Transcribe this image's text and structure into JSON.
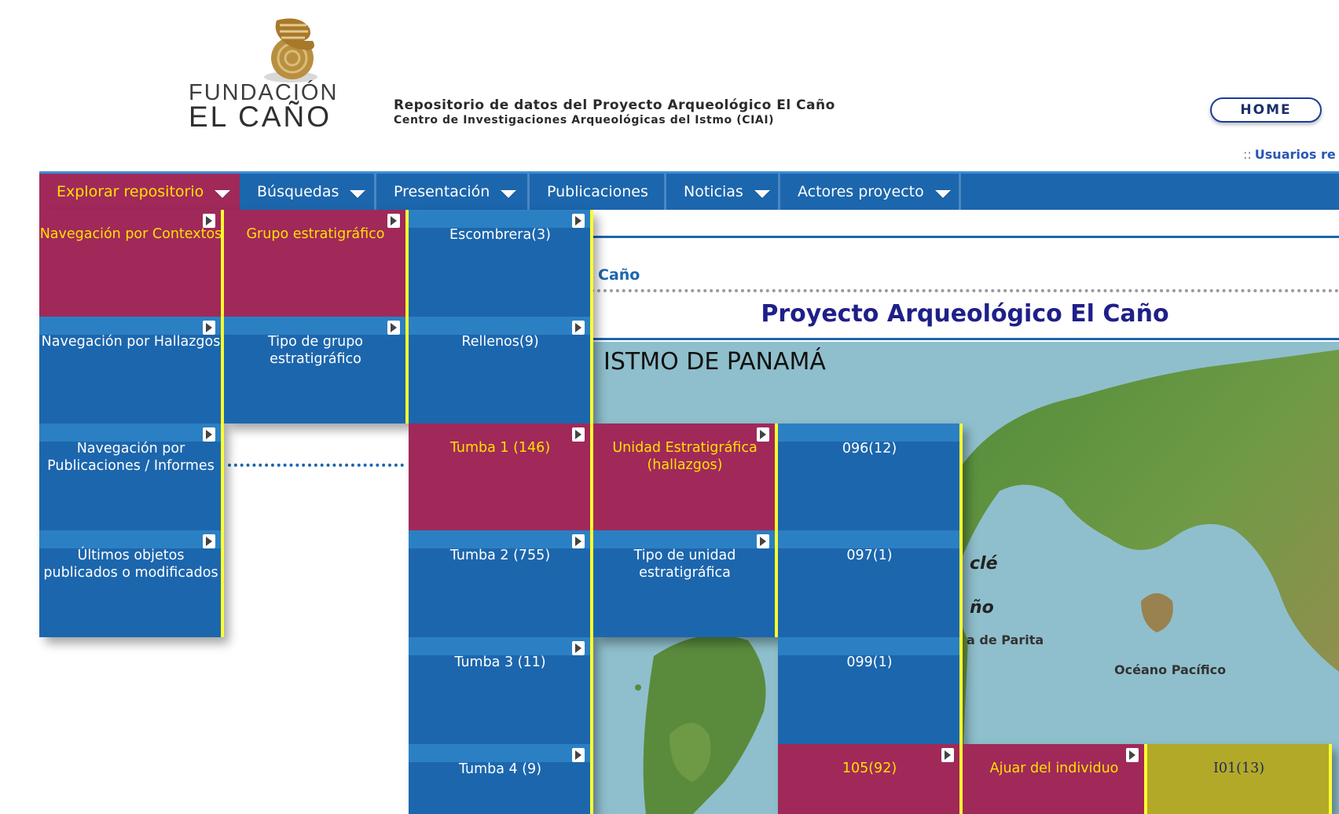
{
  "header": {
    "logo_line1": "FUNDACIÓN",
    "logo_line2": "EL CAÑO",
    "repo_title": "Repositorio de datos del Proyecto Arqueológico El Caño",
    "repo_subtitle": "Centro de Investigaciones Arqueológicas del Istmo (CIAI)",
    "home_label": "HOME",
    "users_sep": "::",
    "users_label": "Usuarios re"
  },
  "nav": {
    "items": [
      {
        "label": "Explorar repositorio",
        "has_menu": true,
        "active": true
      },
      {
        "label": "Búsquedas",
        "has_menu": true
      },
      {
        "label": "Presentación",
        "has_menu": true
      },
      {
        "label": "Publicaciones",
        "has_menu": false
      },
      {
        "label": "Noticias",
        "has_menu": true
      },
      {
        "label": "Actores proyecto",
        "has_menu": true
      }
    ]
  },
  "menu": {
    "col1": [
      "Navegación por Contextos",
      "Navegación por Hallazgos",
      "Navegación por Publicaciones / Informes",
      "Últimos objetos publicados o modificados"
    ],
    "col2": [
      "Grupo estratigráfico",
      "Tipo de grupo estratigráfico"
    ],
    "col3": [
      "Escombrera(3)",
      "Rellenos(9)",
      "Tumba 1 (146)",
      "Tumba 2 (755)",
      "Tumba 3 (11)",
      "Tumba 4 (9)"
    ],
    "col4": [
      "Unidad Estratigráfica (hallazgos)",
      "Tipo de unidad estratigráfica"
    ],
    "col5": [
      "096(12)",
      "097(1)",
      "099(1)",
      "105(92)"
    ],
    "col6": [
      "Ajuar del individuo"
    ],
    "col7": [
      "I01(13)"
    ]
  },
  "content": {
    "breadcrumb": "Caño",
    "project_title": "Proyecto Arqueológico El Caño",
    "map_title": "ISTMO DE PANAMÁ",
    "map_labels": {
      "cle": "clé",
      "no": "ño",
      "parita": "a de Parita",
      "pacifico": "Océano Pacífico"
    }
  },
  "colors": {
    "nav_blue": "#1c66ad",
    "active_red": "#a0295a",
    "highlight_yellow": "#ffe000",
    "olive": "#b3a929",
    "title_navy": "#1f1f8a"
  }
}
